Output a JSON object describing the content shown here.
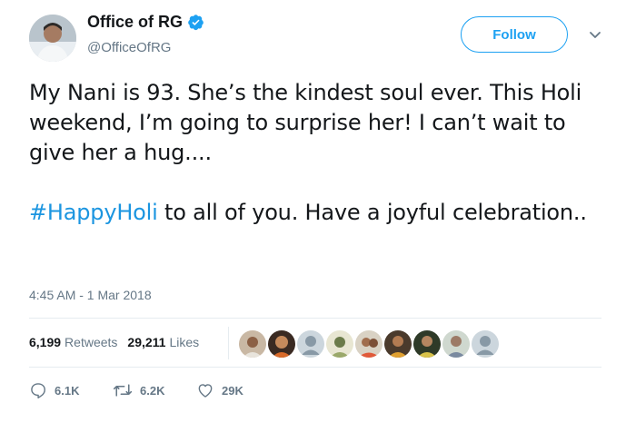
{
  "header": {
    "display_name": "Office of RG",
    "handle": "@OfficeOfRG",
    "follow_label": "Follow"
  },
  "tweet": {
    "paragraph1": "My Nani is 93. She’s the kindest soul ever. This Holi weekend, I’m going to surprise her! I can’t wait to give her a hug....",
    "hashtag": "#HappyHoli",
    "paragraph2_rest": " to all of you. Have a joyful celebration..",
    "timestamp": "4:45 AM - 1 Mar 2018"
  },
  "stats": {
    "retweets_count": "6,199",
    "retweets_label": "Retweets",
    "likes_count": "29,211",
    "likes_label": "Likes"
  },
  "actions": {
    "reply_count": "6.1K",
    "retweet_count": "6.2K",
    "like_count": "29K"
  },
  "colors": {
    "accent": "#1da1f2",
    "hashtag": "#1b95e0",
    "muted": "#657786",
    "divider": "#e6ecf0"
  },
  "icons": [
    "verified-badge-icon",
    "chevron-down-icon",
    "reply-icon",
    "retweet-icon",
    "heart-icon"
  ]
}
